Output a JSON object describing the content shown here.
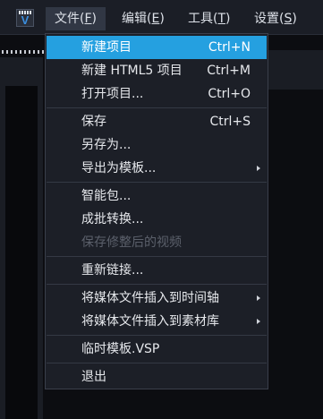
{
  "menubar": {
    "logo_icon": "app-logo-icon",
    "menus": [
      {
        "label": "文件(",
        "key": "F",
        "close": ")"
      },
      {
        "label": "编辑(",
        "key": "E",
        "close": ")"
      },
      {
        "label": "工具(",
        "key": "T",
        "close": ")"
      },
      {
        "label": "设置(",
        "key": "S",
        "close": ")"
      }
    ]
  },
  "file_menu": {
    "items": [
      {
        "label": "新建项目",
        "shortcut": "Ctrl+N"
      },
      {
        "label": "新建 HTML5 项目",
        "shortcut": "Ctrl+M"
      },
      {
        "label": "打开项目...",
        "shortcut": "Ctrl+O"
      },
      {
        "label": "保存",
        "shortcut": "Ctrl+S"
      },
      {
        "label": "另存为..."
      },
      {
        "label": "导出为模板..."
      },
      {
        "label": "智能包..."
      },
      {
        "label": "成批转换..."
      },
      {
        "label": "保存修整后的视频"
      },
      {
        "label": "重新链接..."
      },
      {
        "label": "将媒体文件插入到时间轴"
      },
      {
        "label": "将媒体文件插入到素材库"
      },
      {
        "label": "临时模板.VSP"
      },
      {
        "label": "退出"
      }
    ]
  },
  "colors": {
    "highlight": "#25a0e0",
    "menu_bg": "#1c1f27",
    "disabled_text": "#5b606b"
  }
}
